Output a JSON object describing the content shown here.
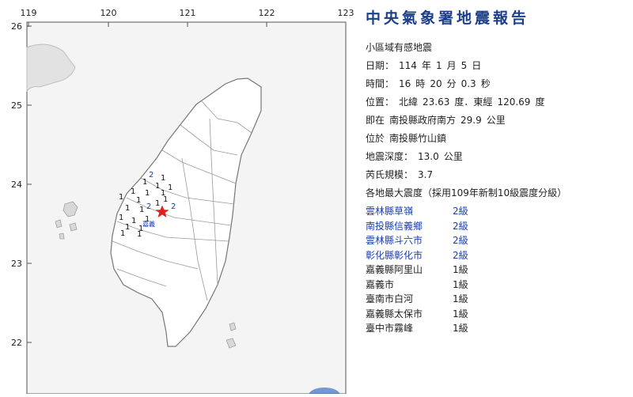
{
  "report": {
    "title": "中央氣象署地震報告",
    "subtitle": "小區域有感地震",
    "date": {
      "label": "日期：",
      "year": "114",
      "year_unit": "年",
      "month": "1",
      "month_unit": "月",
      "day": "5",
      "day_unit": "日"
    },
    "time": {
      "label": "時間：",
      "hour": "16",
      "hour_unit": "時",
      "minute": "20",
      "minute_unit": "分",
      "second": "0.3",
      "second_unit": "秒"
    },
    "position": {
      "label": "位置：",
      "lat_label": "北緯",
      "lat": "23.63",
      "lat_unit": "度",
      "sep": "．",
      "lon_label": "東經",
      "lon": "120.69",
      "lon_unit": "度"
    },
    "ref_prefix": "即在",
    "ref_place": "南投縣政府南方",
    "ref_dist": "29.9",
    "ref_unit": "公里",
    "loc_prefix": "位於",
    "loc_place": "南投縣竹山鎮",
    "depth": {
      "label": "地震深度：",
      "value": "13.0",
      "unit": "公里"
    },
    "magnitude": {
      "label": "芮氏規模：",
      "value": "3.7"
    },
    "intensity_header": "各地最大震度（採用109年新制10級震度分級）",
    "intensities": [
      {
        "place": "雲林縣草嶺",
        "level": "2級",
        "color": "#1a3db0"
      },
      {
        "place": "南投縣信義鄉",
        "level": "2級",
        "color": "#1a3db0"
      },
      {
        "place": "雲林縣斗六市",
        "level": "2級",
        "color": "#1a3db0"
      },
      {
        "place": "彰化縣彰化市",
        "level": "2級",
        "color": "#1a3db0"
      },
      {
        "place": "嘉義縣阿里山",
        "level": "1級",
        "color": "#1f1f1f"
      },
      {
        "place": "嘉義市",
        "level": "1級",
        "color": "#1f1f1f"
      },
      {
        "place": "臺南市白河",
        "level": "1級",
        "color": "#1f1f1f"
      },
      {
        "place": "嘉義縣太保市",
        "level": "1級",
        "color": "#1f1f1f"
      },
      {
        "place": "臺中市霧峰",
        "level": "1級",
        "color": "#1f1f1f"
      }
    ]
  },
  "map": {
    "lon_ticks": [
      "119",
      "120",
      "121",
      "122",
      "123"
    ],
    "lat_ticks": [
      "26",
      "25",
      "24",
      "23",
      "22"
    ],
    "epicenter_color": "#e0201c",
    "epicenter_lon": 120.69,
    "epicenter_lat": 23.63,
    "station_labels_blue": [
      "2",
      "2",
      "2"
    ],
    "station_labels_black": [
      "1",
      "1",
      "1",
      "1",
      "1",
      "1",
      "1",
      "1",
      "1",
      "1",
      "1",
      "1",
      "1",
      "1",
      "1",
      "1",
      "1",
      "1",
      "1",
      "1"
    ],
    "city_label": "嘉義"
  }
}
